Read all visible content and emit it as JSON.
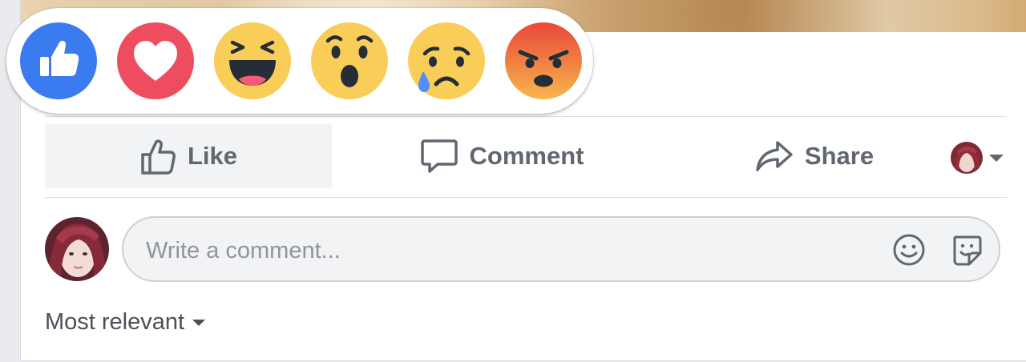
{
  "reactions": [
    {
      "name": "Like",
      "color": "#3b7bf0"
    },
    {
      "name": "Love",
      "color": "#ee4c5f"
    },
    {
      "name": "Haha",
      "color": "#f8cd58"
    },
    {
      "name": "Wow",
      "color": "#f8cd58"
    },
    {
      "name": "Sad",
      "color": "#f8cd58"
    },
    {
      "name": "Angry",
      "color": "#f0733a"
    }
  ],
  "actions": {
    "like_label": "Like",
    "comment_label": "Comment",
    "share_label": "Share"
  },
  "comment_box": {
    "placeholder": "Write a comment..."
  },
  "sort": {
    "label": "Most relevant"
  },
  "colors": {
    "action_text": "#606770",
    "divider": "#dddfe2",
    "input_bg": "#f2f3f5",
    "input_border": "#ccd0d5"
  }
}
